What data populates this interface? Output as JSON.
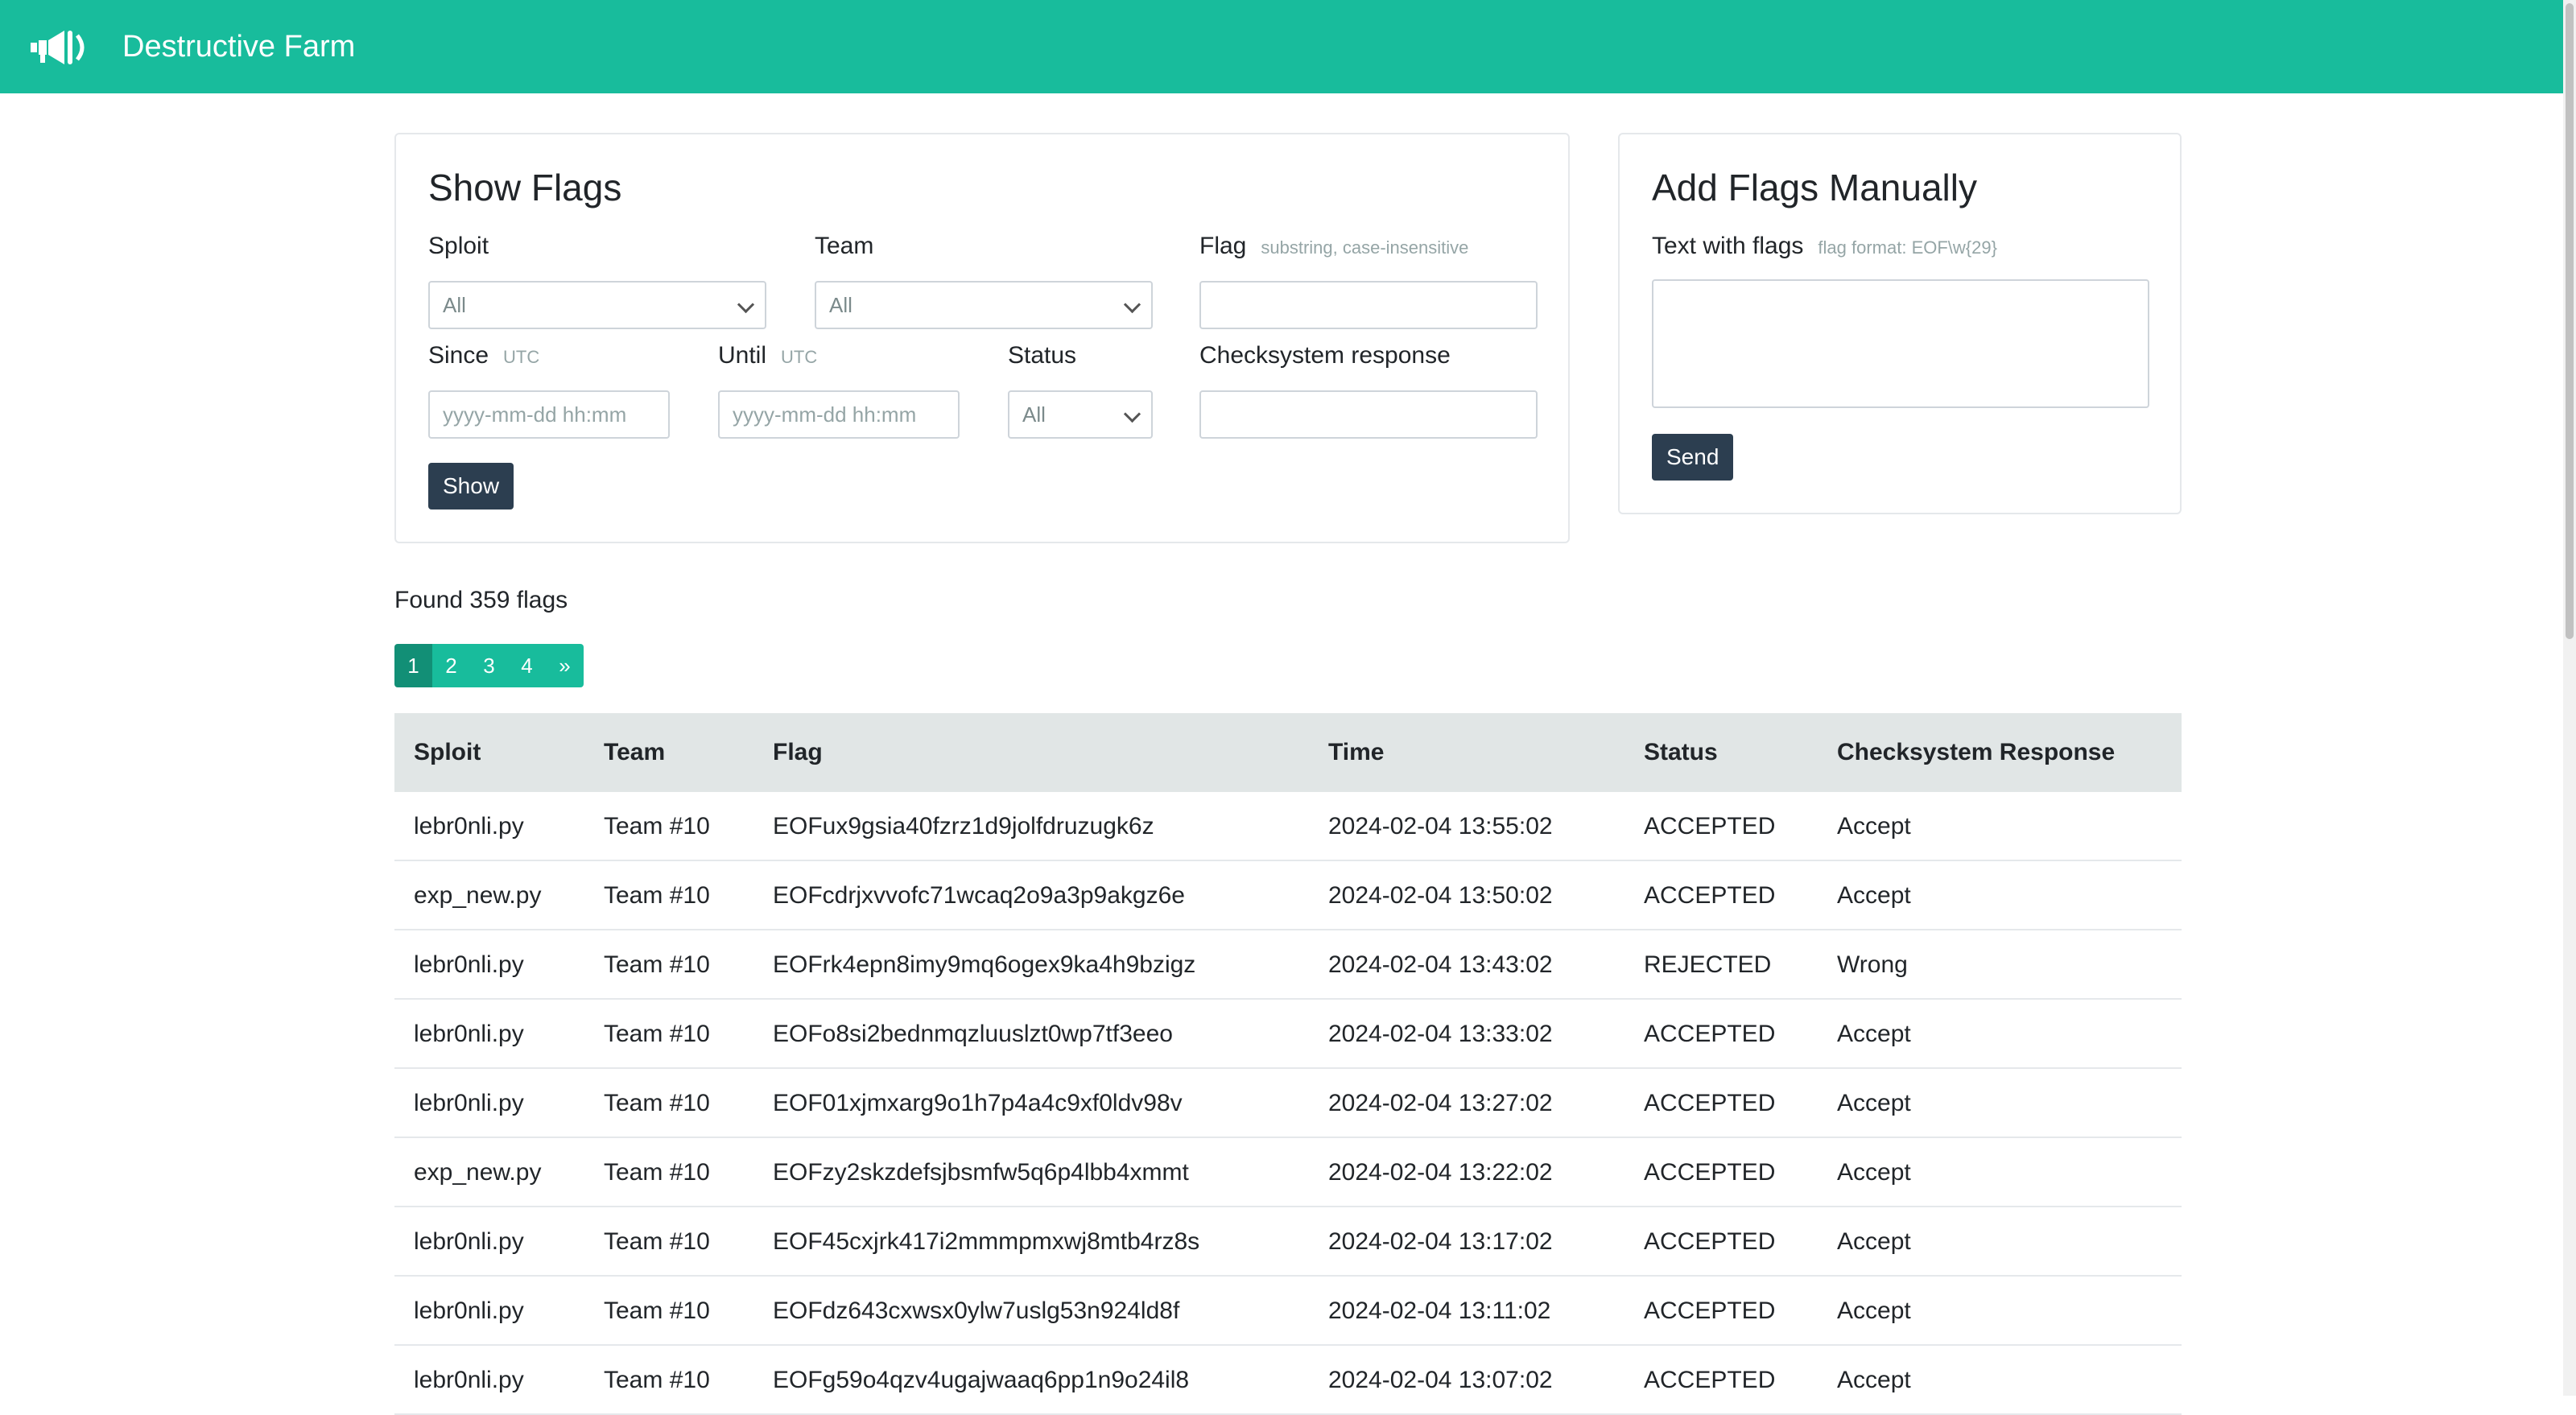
{
  "navbar": {
    "brand": "Destructive Farm",
    "logo_icon": "megaphone-icon",
    "color": "#18bc9c"
  },
  "show_flags": {
    "title": "Show Flags",
    "sploit_label": "Sploit",
    "sploit_value": "All",
    "team_label": "Team",
    "team_value": "All",
    "flag_label": "Flag",
    "flag_hint": "substring, case-insensitive",
    "flag_value": "",
    "since_label": "Since",
    "since_hint": "UTC",
    "since_placeholder": "yyyy-mm-dd hh:mm",
    "until_label": "Until",
    "until_hint": "UTC",
    "until_placeholder": "yyyy-mm-dd hh:mm",
    "status_label": "Status",
    "status_value": "All",
    "checksystem_label": "Checksystem response",
    "checksystem_value": "",
    "show_button": "Show"
  },
  "add_flags": {
    "title": "Add Flags Manually",
    "text_label": "Text with flags",
    "text_hint": "flag format: EOF\\w{29}",
    "send_button": "Send"
  },
  "results": {
    "found_text": "Found 359 flags",
    "pages": [
      "1",
      "2",
      "3",
      "4",
      "»"
    ],
    "active_page": "1"
  },
  "table": {
    "headers": [
      "Sploit",
      "Team",
      "Flag",
      "Time",
      "Status",
      "Checksystem Response"
    ],
    "rows": [
      [
        "lebr0nli.py",
        "Team #10",
        "EOFux9gsia40fzrz1d9jolfdruzugk6z",
        "2024-02-04 13:55:02",
        "ACCEPTED",
        "Accept"
      ],
      [
        "exp_new.py",
        "Team #10",
        "EOFcdrjxvvofc71wcaq2o9a3p9akgz6e",
        "2024-02-04 13:50:02",
        "ACCEPTED",
        "Accept"
      ],
      [
        "lebr0nli.py",
        "Team #10",
        "EOFrk4epn8imy9mq6ogex9ka4h9bzigz",
        "2024-02-04 13:43:02",
        "REJECTED",
        "Wrong"
      ],
      [
        "lebr0nli.py",
        "Team #10",
        "EOFo8si2bednmqzluuslzt0wp7tf3eeo",
        "2024-02-04 13:33:02",
        "ACCEPTED",
        "Accept"
      ],
      [
        "lebr0nli.py",
        "Team #10",
        "EOF01xjmxarg9o1h7p4a4c9xf0ldv98v",
        "2024-02-04 13:27:02",
        "ACCEPTED",
        "Accept"
      ],
      [
        "exp_new.py",
        "Team #10",
        "EOFzy2skzdefsjbsmfw5q6p4lbb4xmmt",
        "2024-02-04 13:22:02",
        "ACCEPTED",
        "Accept"
      ],
      [
        "lebr0nli.py",
        "Team #10",
        "EOF45cxjrk417i2mmmpmxwj8mtb4rz8s",
        "2024-02-04 13:17:02",
        "ACCEPTED",
        "Accept"
      ],
      [
        "lebr0nli.py",
        "Team #10",
        "EOFdz643cxwsx0ylw7uslg53n924ld8f",
        "2024-02-04 13:11:02",
        "ACCEPTED",
        "Accept"
      ],
      [
        "lebr0nli.py",
        "Team #10",
        "EOFg59o4qzv4ugajwaaq6pp1n9o24il8",
        "2024-02-04 13:07:02",
        "ACCEPTED",
        "Accept"
      ]
    ]
  }
}
